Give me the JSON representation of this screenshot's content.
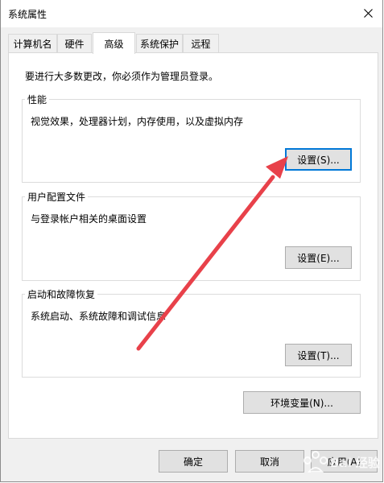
{
  "window": {
    "title": "系统属性"
  },
  "tabs": [
    {
      "label": "计算机名"
    },
    {
      "label": "硬件"
    },
    {
      "label": "高级",
      "active": true
    },
    {
      "label": "系统保护"
    },
    {
      "label": "远程"
    }
  ],
  "notice": "要进行大多数更改，你必须作为管理员登录。",
  "performance": {
    "title": "性能",
    "description": "视觉效果，处理器计划，内存使用，以及虚拟内存",
    "button": "设置(S)..."
  },
  "user_profiles": {
    "title": "用户配置文件",
    "description": "与登录帐户相关的桌面设置",
    "button": "设置(E)..."
  },
  "startup_recovery": {
    "title": "启动和故障恢复",
    "description": "系统启动、系统故障和调试信息",
    "button": "设置(T)..."
  },
  "env_button": "环境变量(N)...",
  "footer": {
    "ok": "确定",
    "cancel": "取消",
    "apply": "应用(A)"
  },
  "watermark": {
    "text": "Bai 经验"
  },
  "colors": {
    "arrow": "#e8414a",
    "focus_border": "#0078d7",
    "dialog_bg": "#f0f0f0"
  }
}
